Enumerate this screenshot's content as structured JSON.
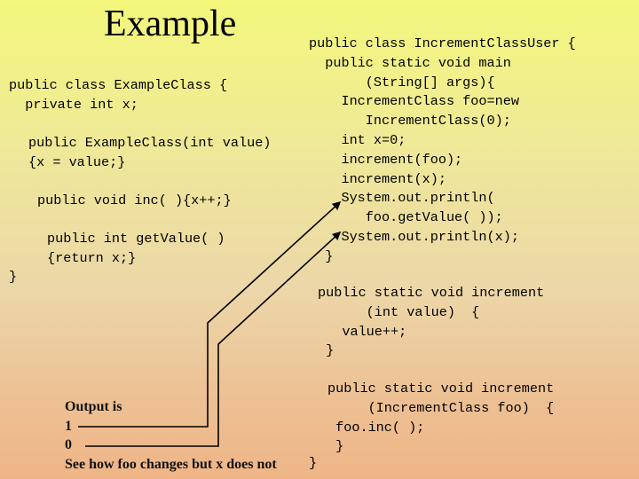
{
  "slide": {
    "title": "Example",
    "background_gradient": [
      "#f3f77c",
      "#efb587"
    ]
  },
  "example_class": {
    "lines": [
      "public class ExampleClass {",
      "  private int x;"
    ],
    "constructor": [
      "public ExampleClass(int value)",
      "{x = value;}"
    ],
    "inc_method": "public void inc( ){x++;}",
    "get_value_method": [
      "public int getValue( )",
      "{return x;}"
    ],
    "closing_brace": "}"
  },
  "increment_class_user": {
    "main": [
      "public class IncrementClassUser {",
      "  public static void main",
      "       (String[] args){",
      "    IncrementClass foo=new",
      "       IncrementClass(0);",
      "    int x=0;",
      "    increment(foo);",
      "    increment(x);",
      "    System.out.println(",
      "       foo.getValue( ));",
      "    System.out.println(x);",
      "  }"
    ],
    "increment_int": [
      "public static void increment",
      "      (int value)  {",
      "   value++;",
      " }"
    ],
    "increment_obj": [
      "public static void increment",
      "     (IncrementClass foo)  {",
      " foo.inc( );",
      " }"
    ],
    "closing_brace": "}"
  },
  "output": {
    "heading": "Output is",
    "values": [
      "1",
      "0"
    ],
    "note": "See how foo changes but x does not"
  }
}
